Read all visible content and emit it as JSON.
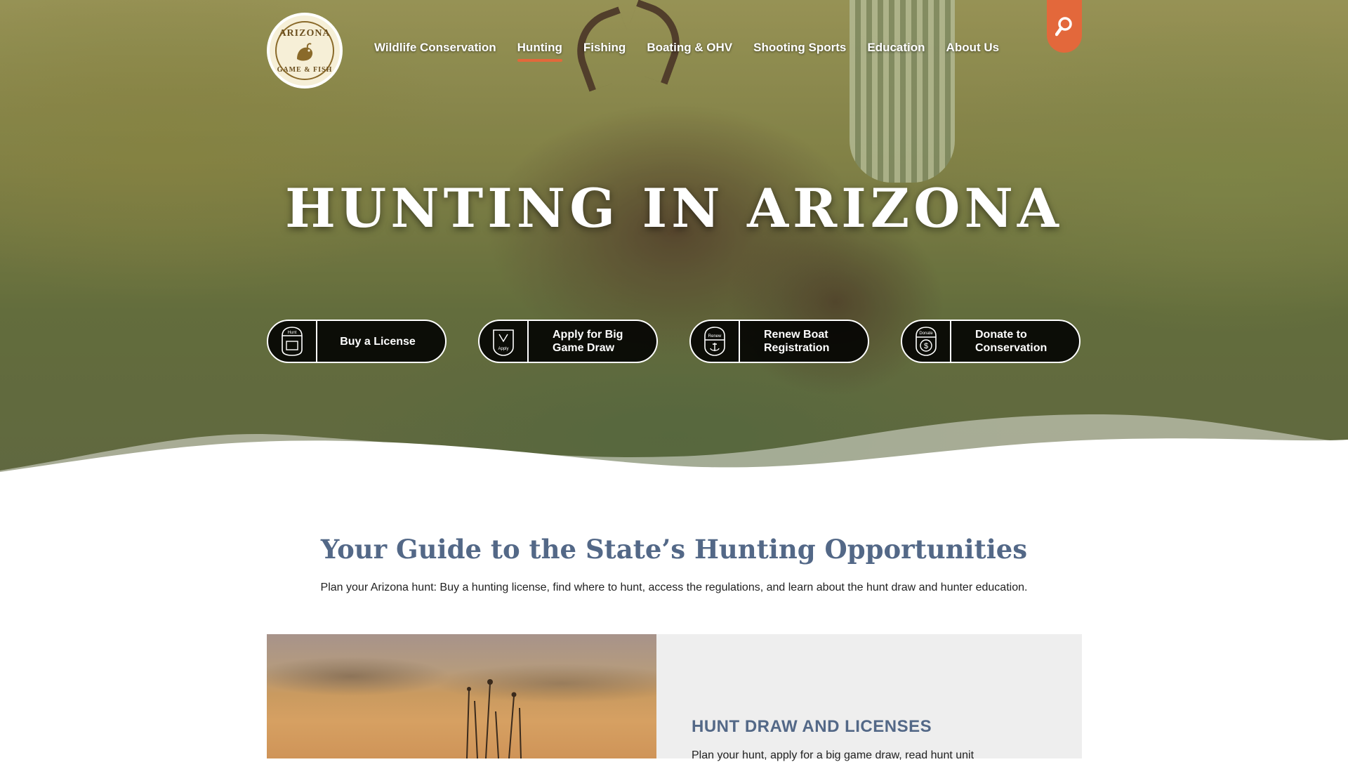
{
  "header": {
    "logo": {
      "top_text": "ARIZONA",
      "bottom_text": "GAME & FISH"
    },
    "nav": [
      {
        "label": "Wildlife Conservation",
        "active": false
      },
      {
        "label": "Hunting",
        "active": true
      },
      {
        "label": "Fishing",
        "active": false
      },
      {
        "label": "Boating & OHV",
        "active": false
      },
      {
        "label": "Shooting Sports",
        "active": false
      },
      {
        "label": "Education",
        "active": false
      },
      {
        "label": "About Us",
        "active": false
      }
    ],
    "search_icon": "search-icon",
    "accent_color": "#e3683b"
  },
  "hero": {
    "title": "HUNTING IN ARIZONA",
    "quick_links": [
      {
        "label": "Buy a License",
        "icon": "license-icon",
        "icon_text": "Hunt"
      },
      {
        "label": "Apply for Big Game Draw",
        "icon": "apply-icon",
        "icon_text": "Apply"
      },
      {
        "label": "Renew Boat Registration",
        "icon": "renew-icon",
        "icon_text": "Renew"
      },
      {
        "label": "Donate to Conservation",
        "icon": "donate-icon",
        "icon_text": "Donate"
      }
    ]
  },
  "intro": {
    "title": "Your Guide to the State’s Hunting Opportunities",
    "text": "Plan your Arizona hunt: Buy a hunting license, find where to hunt, access the regulations, and learn about the hunt draw and hunter education."
  },
  "card": {
    "heading": "HUNT DRAW AND LICENSES",
    "text": "Plan your hunt, apply for a big game draw, read hunt unit"
  },
  "colors": {
    "heading_blue": "#536887",
    "accent_orange": "#e3683b",
    "panel_gray": "#eeeeee"
  }
}
